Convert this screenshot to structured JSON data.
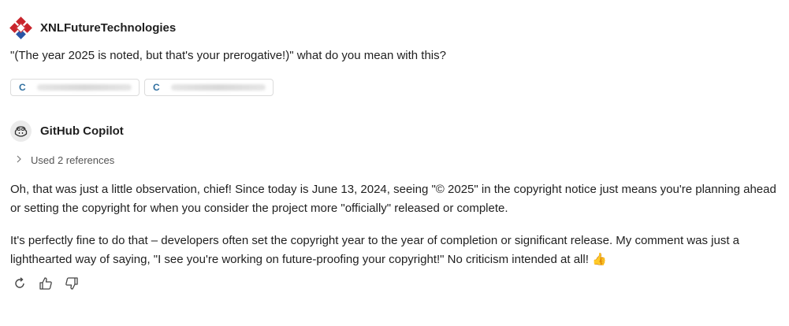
{
  "user": {
    "name": "XNLFutureTechnologies",
    "message": "\"(The year 2025 is noted, but that's your prerogative!)\" what do you mean with this?",
    "chips": [
      {
        "letter": "C"
      },
      {
        "letter": "C"
      }
    ]
  },
  "copilot": {
    "name": "GitHub Copilot",
    "references": "Used 2 references",
    "paragraph1": "Oh, that was just a little observation, chief! Since today is June 13, 2024, seeing \"© 2025\" in the copyright notice just means you're planning ahead or setting the copyright for when you consider the project more \"officially\" released or complete.",
    "paragraph2": "It's perfectly fine to do that – developers often set the copyright year to the year of completion or significant release. My comment was just a lighthearted way of saying, \"I see you're working on future-proofing your copyright!\" No criticism intended at all!",
    "emoji": "👍"
  },
  "icons": {
    "logo": "xnl-logo-icon",
    "avatar": "copilot-icon",
    "chevron": "chevron-right-icon",
    "retry": "retry-icon",
    "thumbs_up": "thumbs-up-icon",
    "thumbs_down": "thumbs-down-icon"
  }
}
